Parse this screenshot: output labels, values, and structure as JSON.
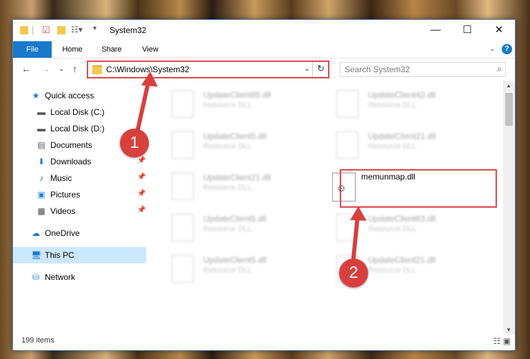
{
  "window": {
    "title": "System32",
    "controls": {
      "minimize": "—",
      "maximize": "☐",
      "close": "✕"
    }
  },
  "ribbon": {
    "tabs": [
      "File",
      "Home",
      "Share",
      "View"
    ],
    "help": "?"
  },
  "navigation": {
    "address_path": "C:\\Windows\\System32",
    "search_placeholder": "Search System32"
  },
  "sidebar": {
    "items": [
      {
        "label": "Quick access",
        "icon": "star-icon"
      },
      {
        "label": "Local Disk (C:)",
        "icon": "drive-icon"
      },
      {
        "label": "Local Disk (D:)",
        "icon": "drive-icon"
      },
      {
        "label": "Documents",
        "icon": "document-icon"
      },
      {
        "label": "Downloads",
        "icon": "download-icon"
      },
      {
        "label": "Music",
        "icon": "music-icon"
      },
      {
        "label": "Pictures",
        "icon": "pictures-icon"
      },
      {
        "label": "Videos",
        "icon": "video-icon"
      },
      {
        "label": "OneDrive",
        "icon": "cloud-icon"
      },
      {
        "label": "This PC",
        "icon": "computer-icon"
      },
      {
        "label": "Network",
        "icon": "network-icon"
      }
    ]
  },
  "files": {
    "blurred": [
      {
        "name": "UpdateClient65.dll",
        "type": "Resource DLL"
      },
      {
        "name": "UpdateClient42.dll",
        "type": "Resource DLL"
      },
      {
        "name": "UpdateClient5.dll",
        "type": "Resource DLL"
      },
      {
        "name": "UpdateClient21.dll",
        "type": "Resource DLL"
      },
      {
        "name": "UpdateClient21.dll",
        "type": "Resource DLL"
      },
      {
        "name": "UpdateClient5.dll",
        "type": "Resource DLL"
      },
      {
        "name": "UpdateClient63.dll",
        "type": "Resource DLL"
      },
      {
        "name": "UpdateClient5.dll",
        "type": "Resource DLL"
      },
      {
        "name": "UpdateClient21.dll",
        "type": "Resource DLL"
      }
    ],
    "target": {
      "name": "memunmap.dll"
    }
  },
  "status": {
    "item_count": "199 items"
  },
  "annotations": {
    "step1": "1",
    "step2": "2",
    "color": "#d8403e"
  }
}
